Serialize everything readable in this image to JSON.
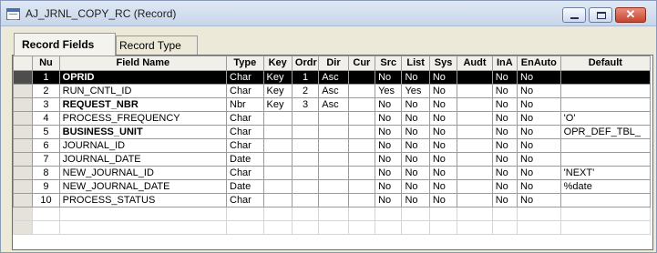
{
  "window": {
    "title": "AJ_JRNL_COPY_RC (Record)",
    "icons": {
      "app": "record-definition-icon",
      "minimize": "minimize-icon",
      "maximize": "maximize-icon",
      "close": "close-icon"
    },
    "close_glyph": "✕"
  },
  "tabs": [
    {
      "label": "Record Fields",
      "active": true
    },
    {
      "label": "Record Type",
      "active": false
    }
  ],
  "grid": {
    "columns": [
      "",
      "Nu",
      "Field Name",
      "Type",
      "Key",
      "Ordr",
      "Dir",
      "Cur",
      "Src",
      "List",
      "Sys",
      "Audt",
      "InA",
      "EnAuto",
      "Default"
    ],
    "rows": [
      {
        "num": "1",
        "name": "OPRID",
        "type": "Char",
        "key": "Key",
        "ordr": "1",
        "dir": "Asc",
        "cur": "",
        "src": "No",
        "list": "No",
        "sys": "No",
        "audt": "",
        "ina": "No",
        "enauto": "No",
        "default": ""
      },
      {
        "num": "2",
        "name": "RUN_CNTL_ID",
        "type": "Char",
        "key": "Key",
        "ordr": "2",
        "dir": "Asc",
        "cur": "",
        "src": "Yes",
        "list": "Yes",
        "sys": "No",
        "audt": "",
        "ina": "No",
        "enauto": "No",
        "default": ""
      },
      {
        "num": "3",
        "name": "REQUEST_NBR",
        "type": "Nbr",
        "key": "Key",
        "ordr": "3",
        "dir": "Asc",
        "cur": "",
        "src": "No",
        "list": "No",
        "sys": "No",
        "audt": "",
        "ina": "No",
        "enauto": "No",
        "default": ""
      },
      {
        "num": "4",
        "name": "PROCESS_FREQUENCY",
        "type": "Char",
        "key": "",
        "ordr": "",
        "dir": "",
        "cur": "",
        "src": "No",
        "list": "No",
        "sys": "No",
        "audt": "",
        "ina": "No",
        "enauto": "No",
        "default": "'O'"
      },
      {
        "num": "5",
        "name": "BUSINESS_UNIT",
        "type": "Char",
        "key": "",
        "ordr": "",
        "dir": "",
        "cur": "",
        "src": "No",
        "list": "No",
        "sys": "No",
        "audt": "",
        "ina": "No",
        "enauto": "No",
        "default": "OPR_DEF_TBL_"
      },
      {
        "num": "6",
        "name": "JOURNAL_ID",
        "type": "Char",
        "key": "",
        "ordr": "",
        "dir": "",
        "cur": "",
        "src": "No",
        "list": "No",
        "sys": "No",
        "audt": "",
        "ina": "No",
        "enauto": "No",
        "default": ""
      },
      {
        "num": "7",
        "name": "JOURNAL_DATE",
        "type": "Date",
        "key": "",
        "ordr": "",
        "dir": "",
        "cur": "",
        "src": "No",
        "list": "No",
        "sys": "No",
        "audt": "",
        "ina": "No",
        "enauto": "No",
        "default": ""
      },
      {
        "num": "8",
        "name": "NEW_JOURNAL_ID",
        "type": "Char",
        "key": "",
        "ordr": "",
        "dir": "",
        "cur": "",
        "src": "No",
        "list": "No",
        "sys": "No",
        "audt": "",
        "ina": "No",
        "enauto": "No",
        "default": "'NEXT'"
      },
      {
        "num": "9",
        "name": "NEW_JOURNAL_DATE",
        "type": "Date",
        "key": "",
        "ordr": "",
        "dir": "",
        "cur": "",
        "src": "No",
        "list": "No",
        "sys": "No",
        "audt": "",
        "ina": "No",
        "enauto": "No",
        "default": "%date"
      },
      {
        "num": "10",
        "name": "PROCESS_STATUS",
        "type": "Char",
        "key": "",
        "ordr": "",
        "dir": "",
        "cur": "",
        "src": "No",
        "list": "No",
        "sys": "No",
        "audt": "",
        "ina": "No",
        "enauto": "No",
        "default": ""
      }
    ]
  }
}
